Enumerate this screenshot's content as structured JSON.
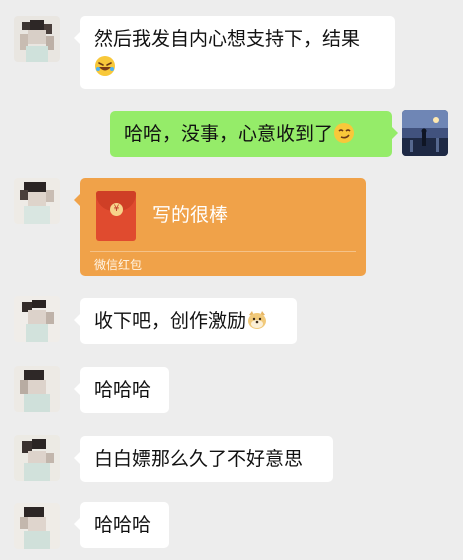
{
  "messages": [
    {
      "side": "left",
      "text_line1": "然后我发自内心想支持下，结果",
      "emoji": "rofl-emoji"
    },
    {
      "side": "right",
      "text": "哈哈，没事，心意收到了",
      "emoji": "smirk-emoji"
    },
    {
      "side": "left",
      "type": "red-packet",
      "title": "写的很棒",
      "footer": "微信红包"
    },
    {
      "side": "left",
      "text": "收下吧，创作激励",
      "emoji": "doge-emoji"
    },
    {
      "side": "left",
      "text": "哈哈哈"
    },
    {
      "side": "left",
      "text": "白白嫖那么久了不好意思"
    },
    {
      "side": "left",
      "text": "哈哈哈"
    }
  ],
  "red_packet_coin_symbol": "¥",
  "colors": {
    "background": "#ededed",
    "left_bubble": "#ffffff",
    "right_bubble": "#95ec69",
    "red_packet": "#f0a249"
  }
}
